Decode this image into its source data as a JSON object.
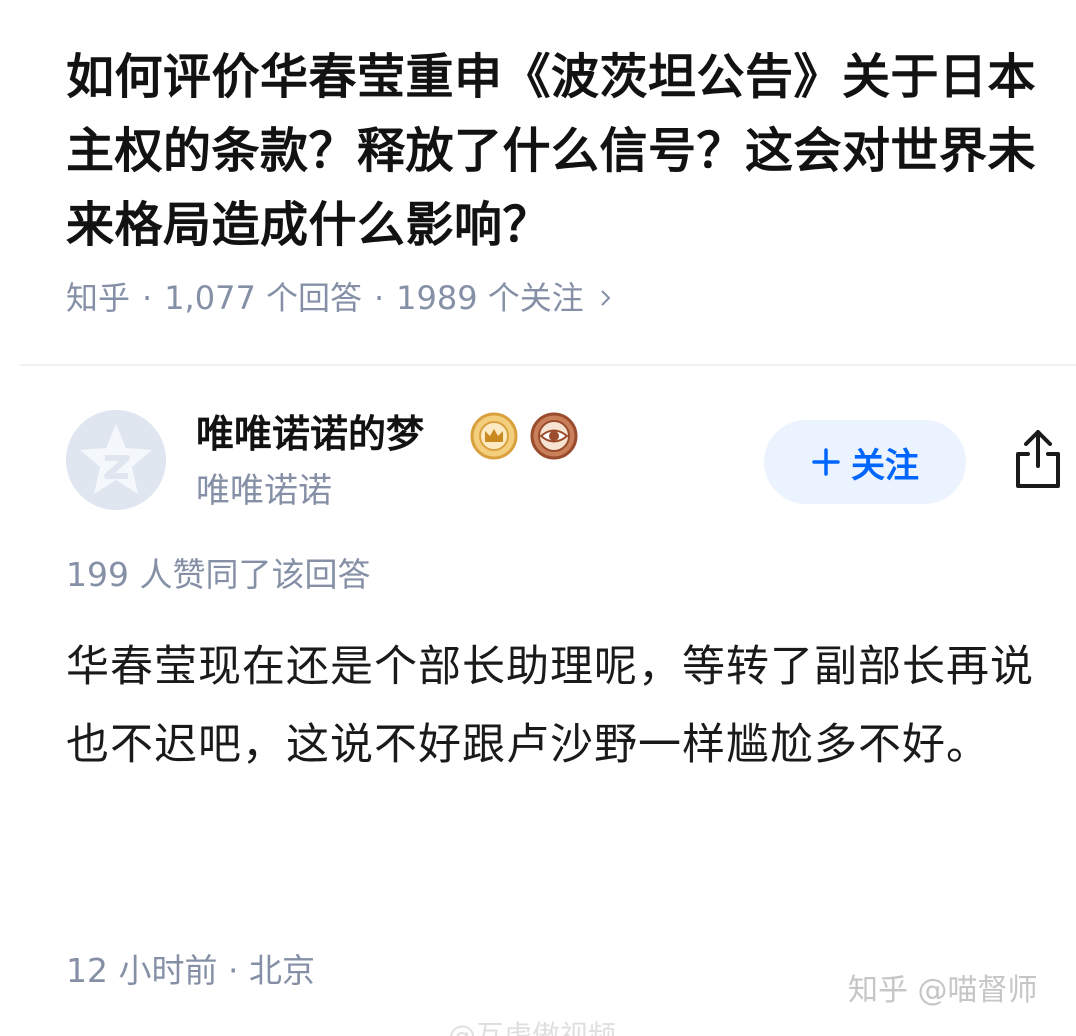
{
  "question": {
    "title": "如何评价华春莹重申《波茨坦公告》关于日本主权的条款？释放了什么信号？这会对世界未来格局造成什么影响？",
    "source": "知乎",
    "answers_count": "1,077 个回答",
    "followers_count": "1989 个关注"
  },
  "author": {
    "name": "唯唯诺诺的梦",
    "headline": "唯唯诺诺",
    "follow_label": "关注"
  },
  "answer": {
    "vote_text": "199 人赞同了该回答",
    "content": "华春莹现在还是个部长助理呢，等转了副部长再说也不迟吧，这说不好跟卢沙野一样尴尬多不好。",
    "time": "12 小时前",
    "location": "北京"
  },
  "watermark": {
    "text": "知乎 @喵督师",
    "bottom_text": "@互虎傲视频"
  },
  "icons": [
    "chevron-right-icon",
    "crown-badge-icon",
    "eye-badge-icon",
    "plus-icon",
    "share-icon",
    "avatar-default-icon"
  ],
  "colors": {
    "accent": "#0066ff",
    "accent_bg": "#ebf3ff",
    "meta": "#8590a6",
    "badge_gold": "#e8b04a",
    "badge_brown": "#b5653c"
  }
}
